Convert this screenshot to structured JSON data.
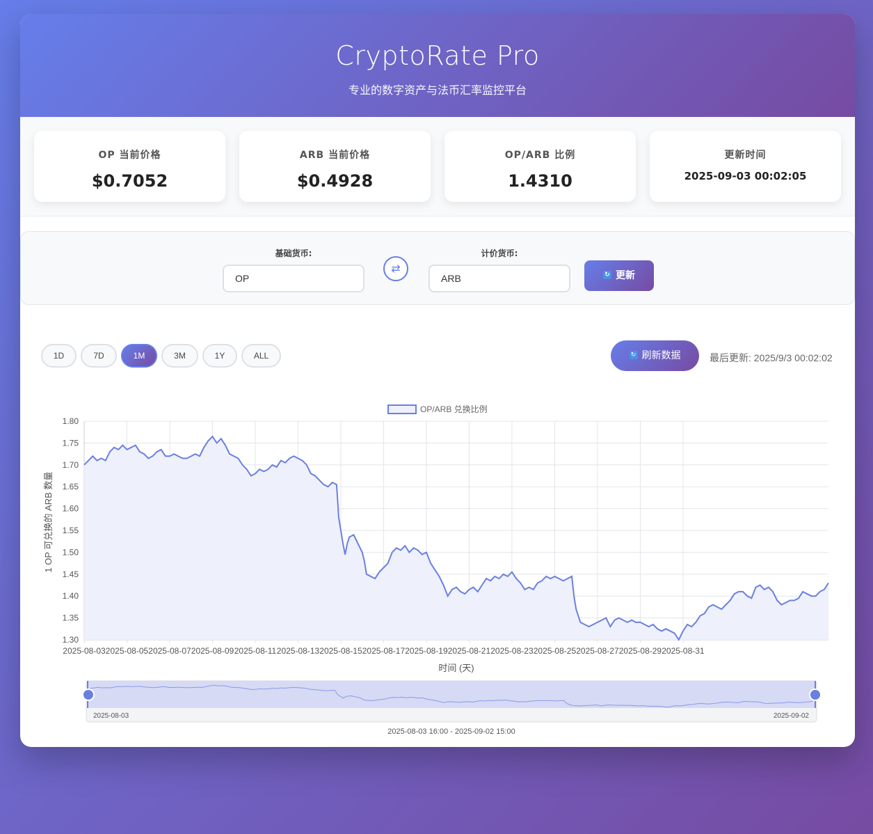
{
  "header": {
    "title": "CryptoRate Pro",
    "subtitle": "专业的数字资产与法币汇率监控平台"
  },
  "stats": [
    {
      "label": "OP 当前价格",
      "value": "$0.7052"
    },
    {
      "label": "ARB 当前价格",
      "value": "$0.4928"
    },
    {
      "label": "OP/ARB 比例",
      "value": "1.4310"
    },
    {
      "label": "更新时间",
      "value": "2025-09-03 00:02:05"
    }
  ],
  "controls": {
    "base_label": "基础货币:",
    "base_value": "OP",
    "quote_label": "计价货币:",
    "quote_value": "ARB",
    "swap_icon": "⇄",
    "update_label": "更新",
    "update_icon": "🔄"
  },
  "toolbar": {
    "periods": [
      {
        "label": "1D",
        "active": false
      },
      {
        "label": "7D",
        "active": false
      },
      {
        "label": "1M",
        "active": true
      },
      {
        "label": "3M",
        "active": false
      },
      {
        "label": "1Y",
        "active": false
      },
      {
        "label": "ALL",
        "active": false
      }
    ],
    "refresh_label": "刷新数据",
    "refresh_icon": "🔄",
    "last_update": "最后更新: 2025/9/3 00:02:02"
  },
  "colors": {
    "accent": "#667eea",
    "accent_dark": "#764ba2",
    "line": "#6b7fe0",
    "fill": "#eef0fb"
  },
  "chart_data": {
    "type": "line",
    "legend": "OP/ARB 兑换比例",
    "xlabel": "时间 (天)",
    "ylabel": "1 OP 可兑换的 ARB 数量",
    "ylim": [
      1.3,
      1.8
    ],
    "yticks": [
      "1.80",
      "1.75",
      "1.70",
      "1.65",
      "1.60",
      "1.55",
      "1.50",
      "1.45",
      "1.40",
      "1.35",
      "1.30"
    ],
    "xticks": [
      "2025-08-03",
      "2025-08-05",
      "2025-08-07",
      "2025-08-09",
      "2025-08-11",
      "2025-08-13",
      "2025-08-15",
      "2025-08-17",
      "2025-08-19",
      "2025-08-21",
      "2025-08-23",
      "2025-08-25",
      "2025-08-27",
      "2025-08-29",
      "2025-08-31"
    ],
    "x_start_day": 0,
    "x_end_day": 30,
    "grid": true,
    "points": [
      [
        0.0,
        1.7
      ],
      [
        0.2,
        1.71
      ],
      [
        0.4,
        1.72
      ],
      [
        0.6,
        1.71
      ],
      [
        0.8,
        1.715
      ],
      [
        1.0,
        1.71
      ],
      [
        1.2,
        1.73
      ],
      [
        1.4,
        1.74
      ],
      [
        1.6,
        1.735
      ],
      [
        1.8,
        1.745
      ],
      [
        2.0,
        1.735
      ],
      [
        2.2,
        1.74
      ],
      [
        2.4,
        1.745
      ],
      [
        2.6,
        1.73
      ],
      [
        2.8,
        1.725
      ],
      [
        3.0,
        1.715
      ],
      [
        3.2,
        1.72
      ],
      [
        3.4,
        1.73
      ],
      [
        3.6,
        1.735
      ],
      [
        3.8,
        1.72
      ],
      [
        4.0,
        1.72
      ],
      [
        4.2,
        1.725
      ],
      [
        4.4,
        1.72
      ],
      [
        4.6,
        1.715
      ],
      [
        4.8,
        1.715
      ],
      [
        5.0,
        1.72
      ],
      [
        5.2,
        1.725
      ],
      [
        5.4,
        1.72
      ],
      [
        5.6,
        1.74
      ],
      [
        5.8,
        1.755
      ],
      [
        6.0,
        1.765
      ],
      [
        6.2,
        1.75
      ],
      [
        6.4,
        1.76
      ],
      [
        6.6,
        1.745
      ],
      [
        6.8,
        1.725
      ],
      [
        7.0,
        1.72
      ],
      [
        7.2,
        1.715
      ],
      [
        7.4,
        1.7
      ],
      [
        7.6,
        1.69
      ],
      [
        7.8,
        1.675
      ],
      [
        8.0,
        1.68
      ],
      [
        8.2,
        1.69
      ],
      [
        8.4,
        1.685
      ],
      [
        8.6,
        1.69
      ],
      [
        8.8,
        1.7
      ],
      [
        9.0,
        1.695
      ],
      [
        9.2,
        1.71
      ],
      [
        9.4,
        1.705
      ],
      [
        9.6,
        1.715
      ],
      [
        9.8,
        1.72
      ],
      [
        10.0,
        1.715
      ],
      [
        10.2,
        1.71
      ],
      [
        10.4,
        1.7
      ],
      [
        10.6,
        1.68
      ],
      [
        10.8,
        1.675
      ],
      [
        11.0,
        1.665
      ],
      [
        11.2,
        1.655
      ],
      [
        11.4,
        1.65
      ],
      [
        11.6,
        1.66
      ],
      [
        11.8,
        1.655
      ],
      [
        11.85,
        1.62
      ],
      [
        11.9,
        1.58
      ],
      [
        12.0,
        1.55
      ],
      [
        12.1,
        1.52
      ],
      [
        12.2,
        1.495
      ],
      [
        12.3,
        1.52
      ],
      [
        12.4,
        1.535
      ],
      [
        12.6,
        1.54
      ],
      [
        12.8,
        1.52
      ],
      [
        13.0,
        1.5
      ],
      [
        13.1,
        1.48
      ],
      [
        13.2,
        1.45
      ],
      [
        13.4,
        1.445
      ],
      [
        13.6,
        1.44
      ],
      [
        13.8,
        1.455
      ],
      [
        14.0,
        1.465
      ],
      [
        14.2,
        1.475
      ],
      [
        14.4,
        1.5
      ],
      [
        14.6,
        1.51
      ],
      [
        14.8,
        1.505
      ],
      [
        15.0,
        1.515
      ],
      [
        15.2,
        1.5
      ],
      [
        15.4,
        1.51
      ],
      [
        15.6,
        1.505
      ],
      [
        15.8,
        1.495
      ],
      [
        16.0,
        1.5
      ],
      [
        16.2,
        1.475
      ],
      [
        16.4,
        1.46
      ],
      [
        16.6,
        1.445
      ],
      [
        16.8,
        1.425
      ],
      [
        17.0,
        1.4
      ],
      [
        17.2,
        1.415
      ],
      [
        17.4,
        1.42
      ],
      [
        17.6,
        1.41
      ],
      [
        17.8,
        1.405
      ],
      [
        18.0,
        1.415
      ],
      [
        18.2,
        1.42
      ],
      [
        18.4,
        1.41
      ],
      [
        18.6,
        1.425
      ],
      [
        18.8,
        1.44
      ],
      [
        19.0,
        1.435
      ],
      [
        19.2,
        1.445
      ],
      [
        19.4,
        1.44
      ],
      [
        19.6,
        1.45
      ],
      [
        19.8,
        1.445
      ],
      [
        20.0,
        1.455
      ],
      [
        20.2,
        1.44
      ],
      [
        20.4,
        1.43
      ],
      [
        20.6,
        1.415
      ],
      [
        20.8,
        1.42
      ],
      [
        21.0,
        1.415
      ],
      [
        21.2,
        1.43
      ],
      [
        21.4,
        1.435
      ],
      [
        21.6,
        1.445
      ],
      [
        21.8,
        1.44
      ],
      [
        22.0,
        1.445
      ],
      [
        22.2,
        1.44
      ],
      [
        22.4,
        1.435
      ],
      [
        22.6,
        1.44
      ],
      [
        22.8,
        1.445
      ],
      [
        22.9,
        1.4
      ],
      [
        23.0,
        1.37
      ],
      [
        23.2,
        1.34
      ],
      [
        23.4,
        1.335
      ],
      [
        23.6,
        1.33
      ],
      [
        23.8,
        1.335
      ],
      [
        24.0,
        1.34
      ],
      [
        24.2,
        1.345
      ],
      [
        24.4,
        1.35
      ],
      [
        24.6,
        1.33
      ],
      [
        24.8,
        1.345
      ],
      [
        25.0,
        1.35
      ],
      [
        25.2,
        1.345
      ],
      [
        25.4,
        1.34
      ],
      [
        25.6,
        1.345
      ],
      [
        25.8,
        1.34
      ],
      [
        26.0,
        1.34
      ],
      [
        26.2,
        1.335
      ],
      [
        26.4,
        1.33
      ],
      [
        26.6,
        1.335
      ],
      [
        26.8,
        1.325
      ],
      [
        27.0,
        1.32
      ],
      [
        27.2,
        1.325
      ],
      [
        27.4,
        1.32
      ],
      [
        27.6,
        1.315
      ],
      [
        27.8,
        1.3
      ],
      [
        28.0,
        1.32
      ],
      [
        28.2,
        1.335
      ],
      [
        28.4,
        1.33
      ],
      [
        28.6,
        1.34
      ],
      [
        28.8,
        1.355
      ],
      [
        29.0,
        1.36
      ],
      [
        29.2,
        1.375
      ],
      [
        29.4,
        1.38
      ],
      [
        29.6,
        1.375
      ],
      [
        29.8,
        1.37
      ],
      [
        30.0,
        1.38
      ],
      [
        30.2,
        1.39
      ],
      [
        30.4,
        1.405
      ],
      [
        30.6,
        1.41
      ],
      [
        30.8,
        1.41
      ],
      [
        31.0,
        1.4
      ],
      [
        31.2,
        1.395
      ],
      [
        31.4,
        1.42
      ],
      [
        31.6,
        1.425
      ],
      [
        31.8,
        1.415
      ],
      [
        32.0,
        1.42
      ],
      [
        32.2,
        1.41
      ],
      [
        32.4,
        1.39
      ],
      [
        32.6,
        1.38
      ],
      [
        32.8,
        1.385
      ],
      [
        33.0,
        1.39
      ],
      [
        33.2,
        1.39
      ],
      [
        33.4,
        1.395
      ],
      [
        33.6,
        1.41
      ],
      [
        33.8,
        1.405
      ],
      [
        34.0,
        1.4
      ],
      [
        34.2,
        1.4
      ],
      [
        34.4,
        1.41
      ],
      [
        34.6,
        1.415
      ],
      [
        34.8,
        1.43
      ]
    ],
    "navigator": {
      "start_label": "2025-08-03",
      "end_label": "2025-09-02",
      "range_label": "2025-08-03 16:00 - 2025-09-02 15:00"
    }
  }
}
